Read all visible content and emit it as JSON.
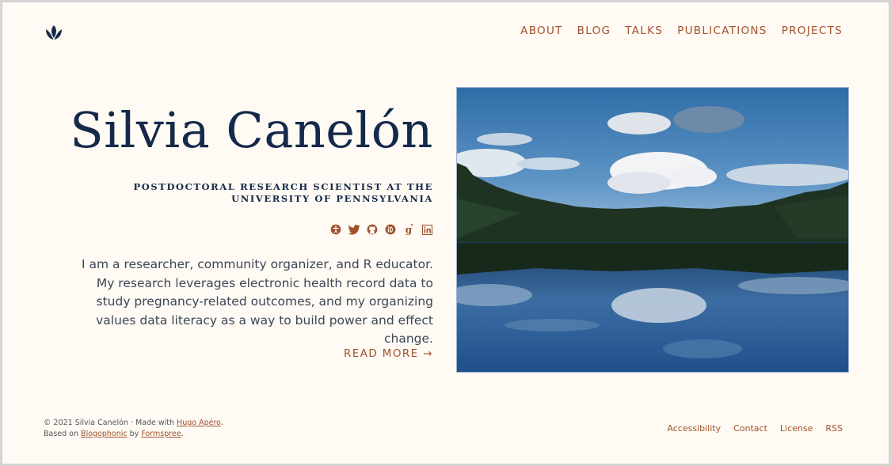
{
  "header": {
    "logo_icon": "tulip-icon",
    "nav": [
      {
        "label": "ABOUT"
      },
      {
        "label": "BLOG"
      },
      {
        "label": "TALKS"
      },
      {
        "label": "PUBLICATIONS"
      },
      {
        "label": "PROJECTS"
      }
    ]
  },
  "hero": {
    "title": "Silvia Canelón",
    "subtitle": "POSTDOCTORAL RESEARCH SCIENTIST AT THE UNIVERSITY OF PENNSYLVANIA",
    "social_icons": [
      "accessibility-icon",
      "twitter-icon",
      "github-icon",
      "orcid-icon",
      "google-scholar-icon",
      "linkedin-icon"
    ],
    "body": "I am a researcher, community organizer, and R educator. My research leverages electronic health record data to study pregnancy-related outcomes, and my organizing values data literacy as a way to build power and effect change.",
    "read_more": "READ MORE →",
    "image": "lake-landscape-photo"
  },
  "footer": {
    "copyright": "© 2021 Silvia Canelón",
    "separator": " · ",
    "made_with": "Made with ",
    "hugo_apero": "Hugo Apéro",
    "period1": ".",
    "based_on": "Based on ",
    "blogophonic": "Blogophonic",
    "by": " by ",
    "formspree": "Formspree",
    "period2": ".",
    "links": [
      {
        "label": "Accessibility"
      },
      {
        "label": "Contact"
      },
      {
        "label": "License"
      },
      {
        "label": "RSS"
      }
    ]
  },
  "colors": {
    "background": "#fffaf3",
    "accent": "#a0522d",
    "heading": "#15294a"
  }
}
